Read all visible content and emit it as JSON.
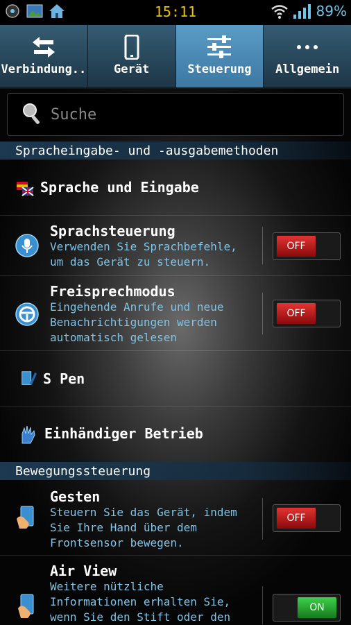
{
  "status_bar": {
    "time": "15:11",
    "battery": "89%"
  },
  "tabs": [
    {
      "label": "Verbindung..",
      "icon": "arrows-swap-icon"
    },
    {
      "label": "Gerät",
      "icon": "phone-icon"
    },
    {
      "label": "Steuerung",
      "icon": "sliders-icon"
    },
    {
      "label": "Allgemein",
      "icon": "more-dots-icon"
    }
  ],
  "search": {
    "placeholder": "Suche"
  },
  "sections": {
    "speech": "Spracheingabe- und -ausgabemethoden",
    "motion": "Bewegungssteuerung"
  },
  "items": {
    "language": {
      "title": "Sprache und Eingabe"
    },
    "voice_control": {
      "title": "Sprachsteuerung",
      "desc_line1": "Verwenden Sie Sprachbefehle,",
      "desc_line2": "um das Gerät zu steuern.",
      "toggle": "OFF"
    },
    "handsfree": {
      "title": "Freisprechmodus",
      "desc_line1": "Eingehende Anrufe und neue",
      "desc_line2": "Benachrichtigungen werden",
      "desc_line3": "automatisch gelesen",
      "toggle": "OFF"
    },
    "spen": {
      "title": "S Pen"
    },
    "onehand": {
      "title": "Einhändiger Betrieb"
    },
    "gestures": {
      "title": "Gesten",
      "desc_line1": "Steuern Sie das Gerät, indem",
      "desc_line2": "Sie Ihre Hand über dem",
      "desc_line3": "Frontsensor bewegen.",
      "toggle": "OFF"
    },
    "airview": {
      "title": "Air View",
      "desc_line1": "Weitere nützliche",
      "desc_line2": "Informationen erhalten Sie,",
      "desc_line3": "wenn Sie den Stift oder den",
      "toggle": "ON"
    }
  }
}
